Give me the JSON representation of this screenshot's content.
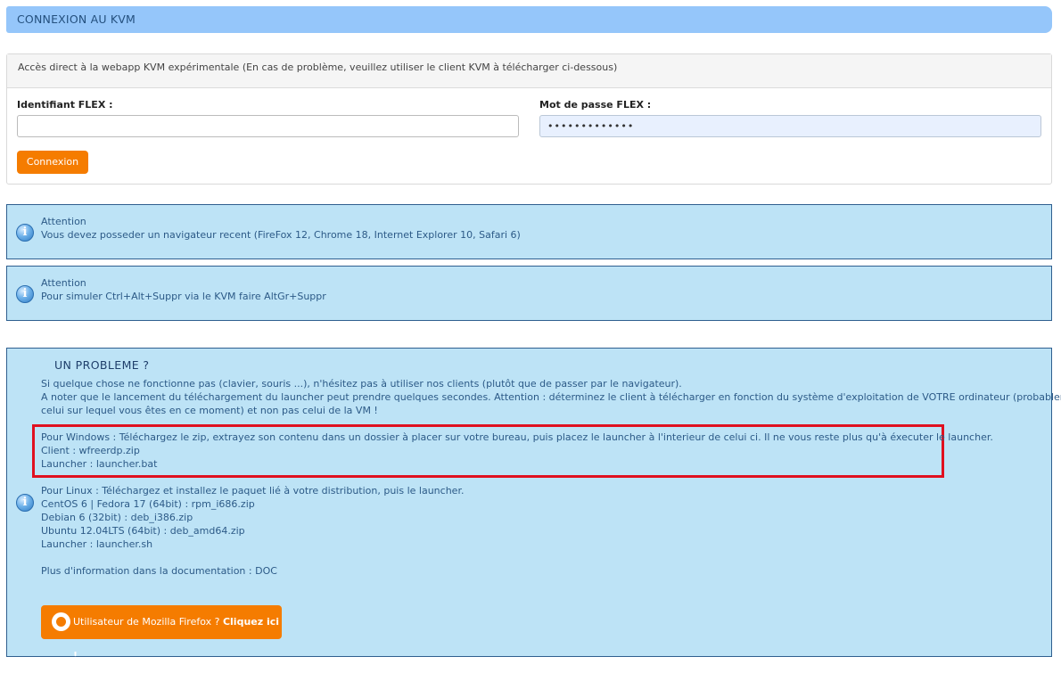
{
  "header": {
    "title": "CONNEXION AU KVM"
  },
  "login_panel": {
    "description": "Accès direct à la webapp KVM expérimentale (En cas de problème, veuillez utiliser le client KVM à télécharger ci-dessous)",
    "username_label": "Identifiant FLEX :",
    "username_value": "",
    "password_label": "Mot de passe FLEX :",
    "password_value": "•••••••••••••",
    "submit_label": "Connexion"
  },
  "notices": [
    {
      "title": "Attention",
      "text": "Vous devez posseder un navigateur recent (FireFox 12, Chrome 18, Internet Explorer 10, Safari 6)"
    },
    {
      "title": "Attention",
      "text": "Pour simuler Ctrl+Alt+Suppr via le KVM faire AltGr+Suppr"
    }
  ],
  "problem": {
    "title": "UN PROBLEME ?",
    "intro_1": "Si quelque chose ne fonctionne pas (clavier, souris ...), n'hésitez pas à utiliser nos clients (plutôt que de passer par le navigateur).",
    "intro_2": "A noter que le lancement du téléchargement du launcher peut prendre quelques secondes. Attention : déterminez le client à télécharger en fonction du système d'exploitation de VOTRE ordinateur (probablement",
    "intro_3": "celui sur lequel vous êtes en ce moment) et non pas celui de la VM !",
    "windows": {
      "line_1": "Pour Windows : Téléchargez le zip, extrayez son contenu dans un dossier à placer sur votre bureau, puis placez le launcher à l'interieur de celui ci. Il ne vous reste plus qu'à éxecuter le launcher.",
      "client": "Client : wfreerdp.zip",
      "launcher": "Launcher : launcher.bat"
    },
    "linux": {
      "line_1": "Pour Linux : Téléchargez et installez le paquet lié à votre distribution, puis le launcher.",
      "centos": "CentOS 6 | Fedora 17 (64bit) : rpm_i686.zip",
      "debian": "Debian 6 (32bit) : deb_i386.zip",
      "ubuntu": "Ubuntu 12.04LTS (64bit) : deb_amd64.zip",
      "launcher": "Launcher : launcher.sh"
    },
    "doc": "Plus d'information dans la documentation : DOC",
    "firefox_button": {
      "text": "Utilisateur de Mozilla Firefox ? ",
      "strong": "Cliquez ici !"
    }
  },
  "colors": {
    "header_bg": "#95c6fa",
    "accent": "#f57c00",
    "info_bg": "#bde3f6",
    "highlight": "#e0101f"
  },
  "icons": {
    "info": "info-icon",
    "firefox": "firefox-icon"
  }
}
